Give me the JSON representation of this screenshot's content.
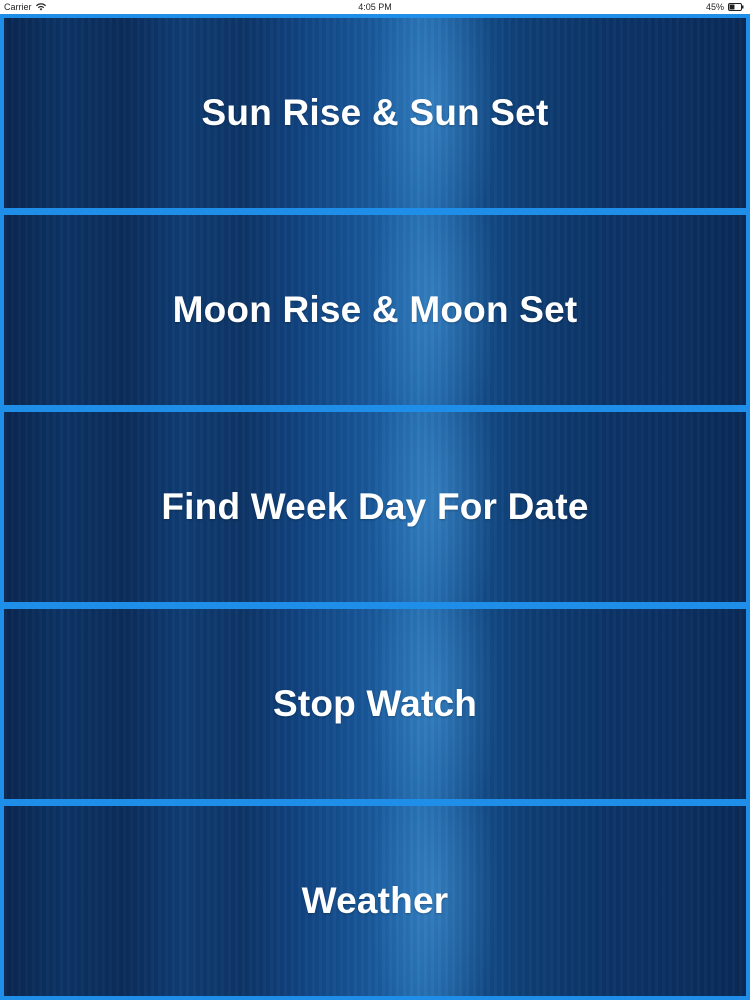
{
  "status_bar": {
    "carrier": "Carrier",
    "wifi_icon": "wifi-icon",
    "time": "4:05 PM",
    "battery_percent": "45%",
    "battery_icon": "battery-icon",
    "battery_level": 0.45
  },
  "menu": {
    "items": [
      {
        "label": "Sun Rise & Sun Set"
      },
      {
        "label": "Moon Rise & Moon Set"
      },
      {
        "label": "Find Week Day For Date"
      },
      {
        "label": "Stop Watch"
      },
      {
        "label": "Weather"
      }
    ]
  },
  "colors": {
    "accent_border": "#1f8ee8",
    "button_dark": "#0b2c5a",
    "button_text": "#ffffff"
  }
}
